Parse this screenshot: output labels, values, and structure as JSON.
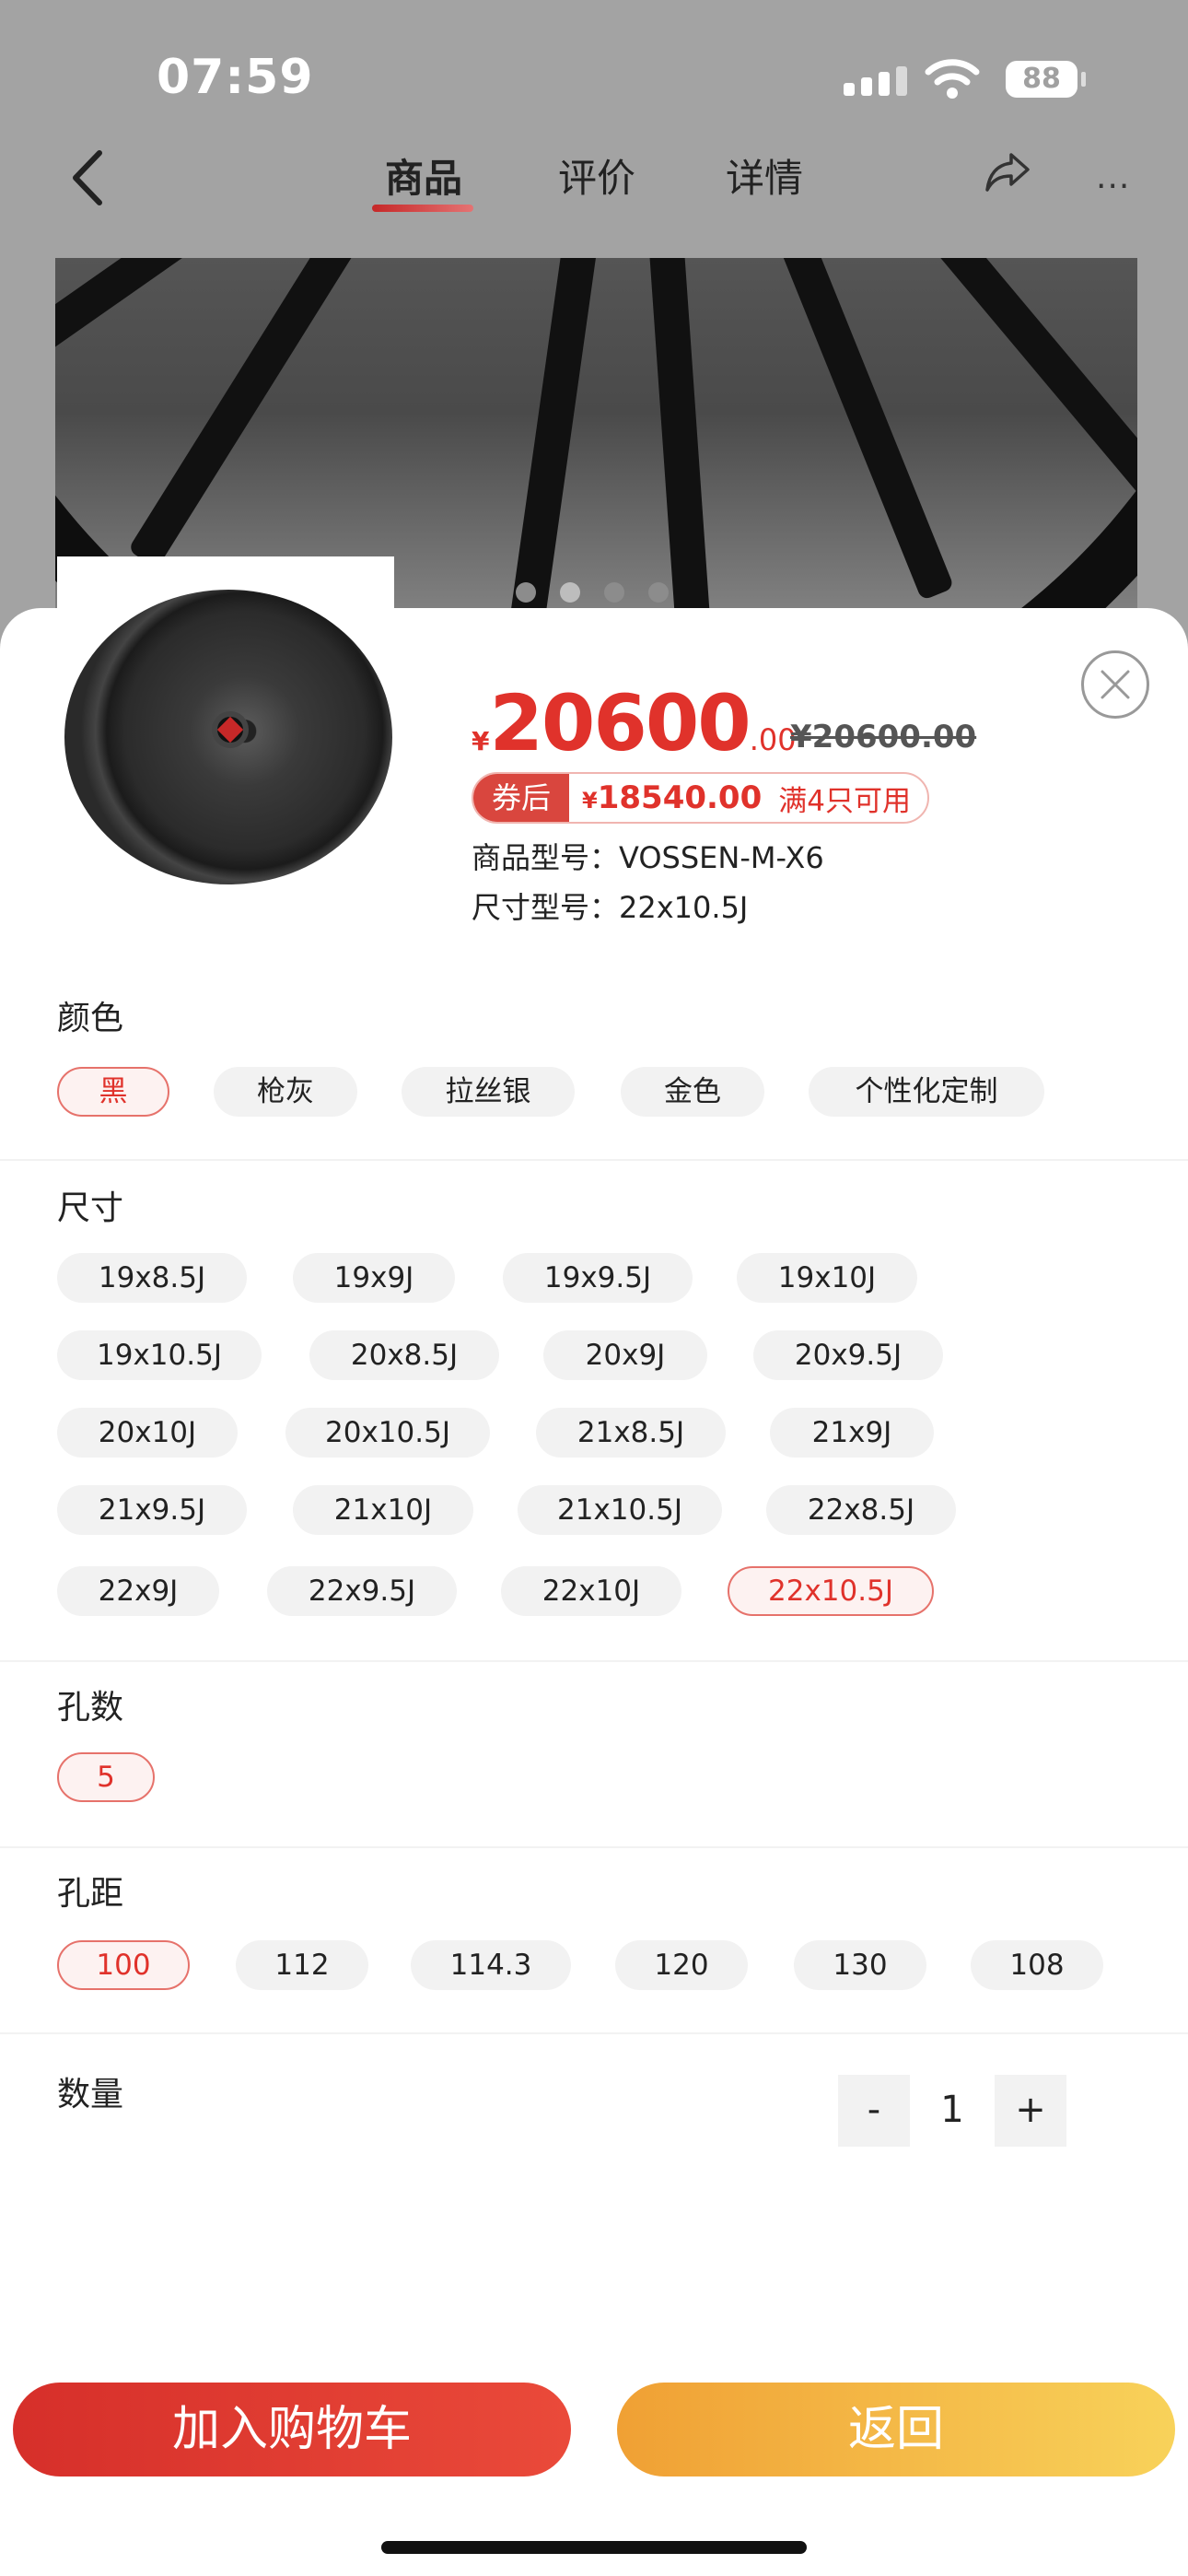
{
  "status": {
    "time": "07:59",
    "battery": "88"
  },
  "nav": {
    "tabs": [
      {
        "label": "商品",
        "active": true
      },
      {
        "label": "评价",
        "active": false
      },
      {
        "label": "详情",
        "active": false
      }
    ],
    "back_icon": "chevron-left-icon",
    "share_icon": "share-icon",
    "more_icon": "more-icon",
    "more": "···"
  },
  "gallery": {
    "pages": 4,
    "current": 2
  },
  "product": {
    "price_currency": "¥",
    "price_int": "20600",
    "price_dec": ".00",
    "orig_price": "¥20600.00",
    "coupon_tag": "券后",
    "coupon_currency": "¥",
    "coupon_price": "18540.00",
    "coupon_note": "满4只可用",
    "model_label": "商品型号：",
    "model_value": "VOSSEN-M-X6",
    "size_label": "尺寸型号：",
    "size_value": "22x10.5J"
  },
  "options": {
    "color": {
      "title": "颜色",
      "items": [
        "黑",
        "枪灰",
        "拉丝银",
        "金色",
        "个性化定制"
      ],
      "selected": "黑"
    },
    "size": {
      "title": "尺寸",
      "items": [
        "19x8.5J",
        "19x9J",
        "19x9.5J",
        "19x10J",
        "19x10.5J",
        "20x8.5J",
        "20x9J",
        "20x9.5J",
        "20x10J",
        "20x10.5J",
        "21x8.5J",
        "21x9J",
        "21x9.5J",
        "21x10J",
        "21x10.5J",
        "22x8.5J",
        "22x9J",
        "22x9.5J",
        "22x10J",
        "22x10.5J"
      ],
      "selected": "22x10.5J"
    },
    "holes": {
      "title": "孔数",
      "items": [
        "5"
      ],
      "selected": "5"
    },
    "pcd": {
      "title": "孔距",
      "items": [
        "100",
        "112",
        "114.3",
        "120",
        "130",
        "108"
      ],
      "selected": "100"
    }
  },
  "quantity": {
    "title": "数量",
    "minus": "-",
    "value": "1",
    "plus": "+"
  },
  "actions": {
    "add_to_cart": "加入购物车",
    "back": "返回"
  },
  "colors": {
    "accent": "#e0322b",
    "cart_button": "#d62f2a",
    "back_button": "#f0a034"
  }
}
